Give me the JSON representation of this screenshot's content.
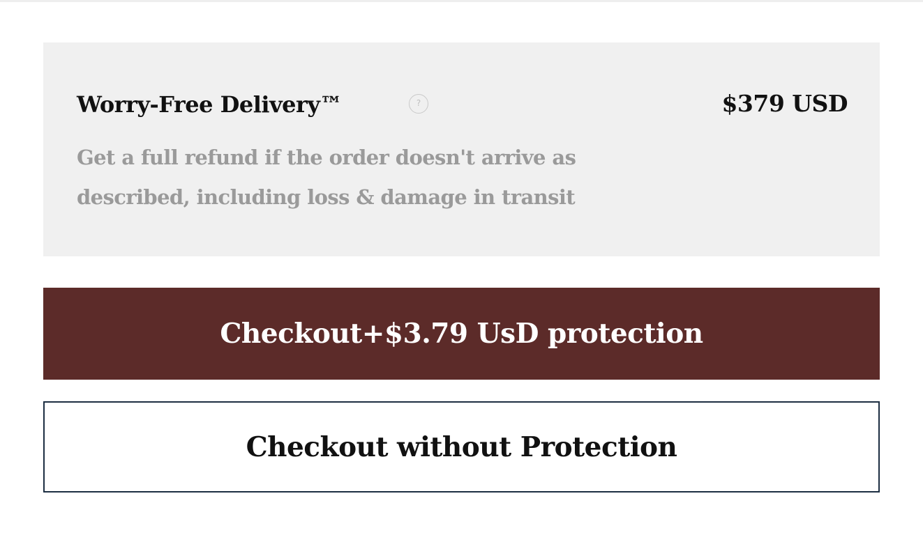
{
  "protection": {
    "title": "Worry-Free Delivery™",
    "help_icon": "question-mark-icon",
    "help_glyph": "?",
    "price": "$379 USD",
    "description": "Get a full refund if the order doesn't arrive as described, including loss & damage in transit"
  },
  "actions": {
    "checkout_with_protection_label": "Checkout+$3.79 UsD protection",
    "checkout_without_protection_label": "Checkout without Protection"
  },
  "colors": {
    "card_background": "#f0f0f0",
    "primary_button": "#5c2b29",
    "secondary_border": "#1c2e42",
    "muted_text": "#9a9a9a"
  }
}
